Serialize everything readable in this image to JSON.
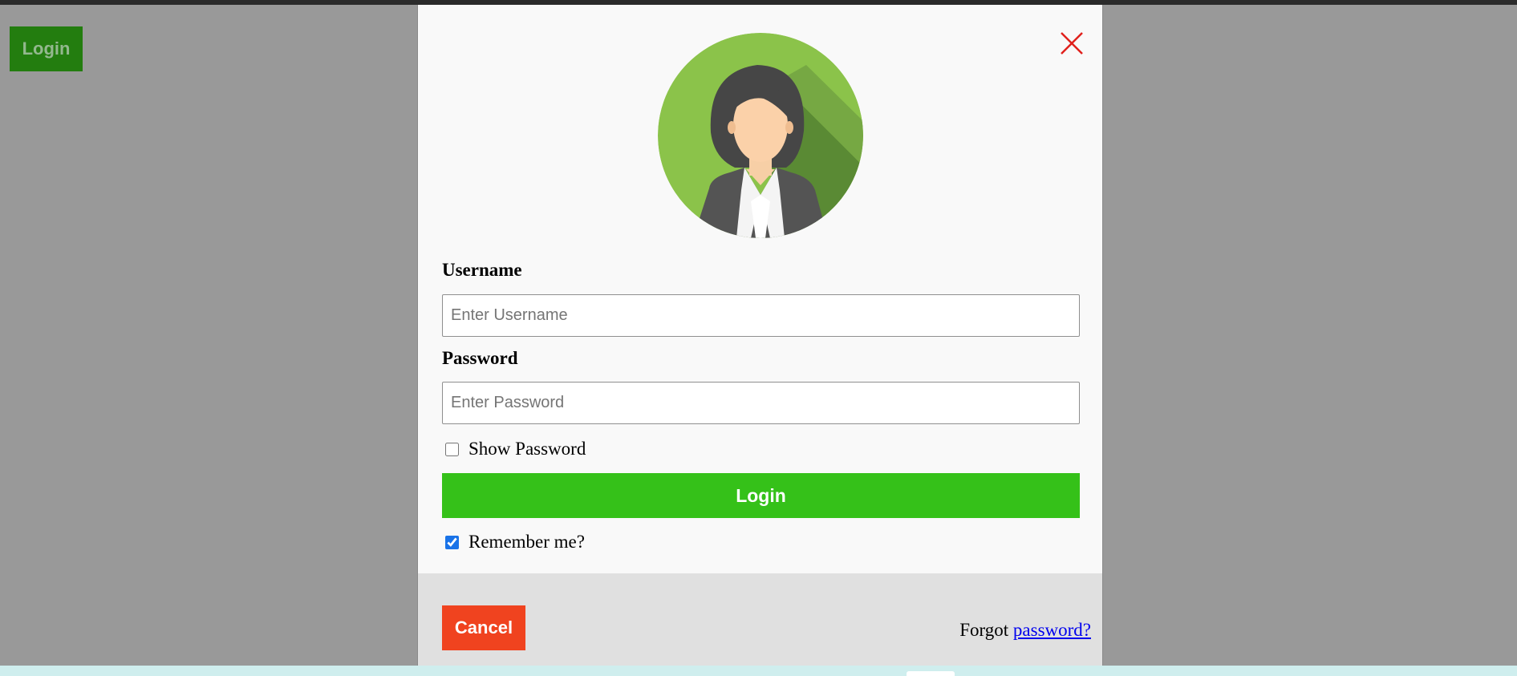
{
  "page": {
    "open_login_label": "Login"
  },
  "modal": {
    "close_icon": "close-icon",
    "avatar_icon": "female-avatar-icon",
    "username": {
      "label": "Username",
      "placeholder": "Enter Username",
      "value": ""
    },
    "password": {
      "label": "Password",
      "placeholder": "Enter Password",
      "value": ""
    },
    "show_password": {
      "label": "Show Password",
      "checked": false
    },
    "submit_label": "Login",
    "remember_me": {
      "label": "Remember me?",
      "checked": true
    },
    "footer": {
      "cancel_label": "Cancel",
      "forgot_prefix": "Forgot",
      "forgot_link": "password?"
    }
  },
  "colors": {
    "overlay": "#999999",
    "open_button_bg": "#237d0f",
    "submit_bg": "#35c119",
    "cancel_bg": "#f0431f",
    "close_icon": "#e0201c",
    "link": "#0000ee",
    "avatar_bg": "#8bc34a"
  }
}
